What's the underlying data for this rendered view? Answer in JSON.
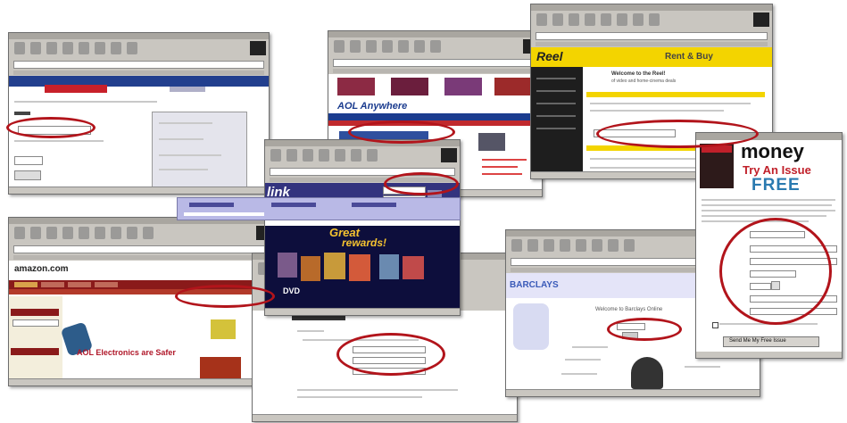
{
  "collage": {
    "aol": {
      "brand": "AOL Anywhere",
      "accent": "#1b3c8f"
    },
    "reel": {
      "brand": "Reel",
      "banner": "Rent & Buy",
      "welcome": "Welcome to the Reel!",
      "sub": "of video and home-cinema deals"
    },
    "link": {
      "brand": "link",
      "promo_top": "Great",
      "promo_bottom": "rewards!",
      "dvd_label": "DVD"
    },
    "amazon": {
      "brand": "amazon.com",
      "promo": "AOL Electronics are Safer"
    },
    "barclays": {
      "brand": "BARCLAYS",
      "welcome": "Welcome to Barclays Online"
    },
    "money": {
      "brand": "money",
      "offer": "Try An Issue",
      "free": "FREE",
      "submit_label": "Send Me My Free Issue"
    },
    "colors": {
      "highlight_oval": "#b2141b",
      "chrome": "#c9c6c0"
    }
  }
}
